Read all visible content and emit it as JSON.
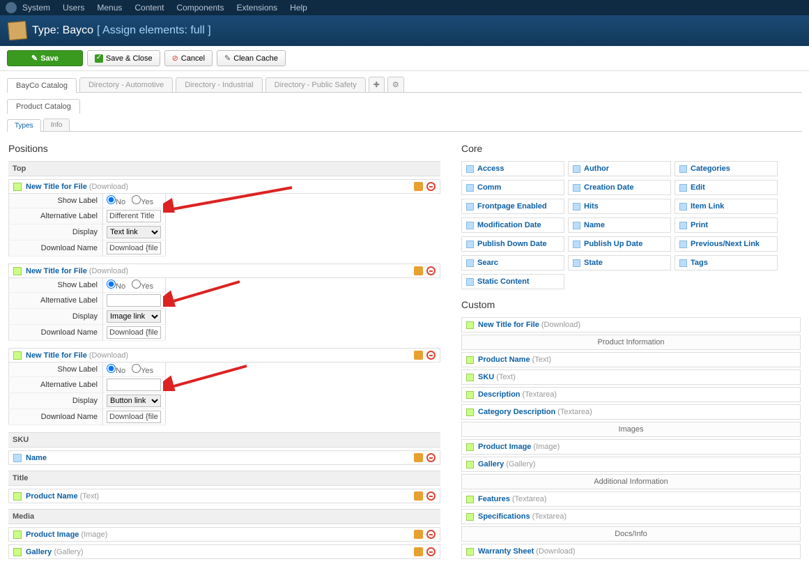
{
  "adminbar": [
    "System",
    "Users",
    "Menus",
    "Content",
    "Components",
    "Extensions",
    "Help"
  ],
  "header": {
    "title": "Type: Bayco",
    "sub": "[ Assign elements: full ]"
  },
  "toolbar": {
    "save": "Save",
    "saveclose": "Save & Close",
    "cancel": "Cancel",
    "clean": "Clean Cache"
  },
  "tabs1": [
    "BayCo Catalog",
    "Directory - Automotive",
    "Directory - Industrial",
    "Directory - Public Safety"
  ],
  "tabs2": [
    "Product Catalog"
  ],
  "subtabs": [
    "Types",
    "Info"
  ],
  "left_title": "Positions",
  "top": {
    "head": "Top",
    "items": [
      {
        "name": "New Title for File",
        "type": "(Download)",
        "show_label": "Show Label",
        "no": "No",
        "yes": "Yes",
        "alt": "Alternative Label",
        "alt_val": "Different Title",
        "disp": "Display",
        "disp_val": "Text link",
        "dn": "Download Name",
        "dn_val": "Download {filenan"
      },
      {
        "name": "New Title for File",
        "type": "(Download)",
        "show_label": "Show Label",
        "no": "No",
        "yes": "Yes",
        "alt": "Alternative Label",
        "alt_val": "",
        "disp": "Display",
        "disp_val": "Image link",
        "dn": "Download Name",
        "dn_val": "Download {filenan"
      },
      {
        "name": "New Title for File",
        "type": "(Download)",
        "show_label": "Show Label",
        "no": "No",
        "yes": "Yes",
        "alt": "Alternative Label",
        "alt_val": "",
        "disp": "Display",
        "disp_val": "Button link",
        "dn": "Download Name",
        "dn_val": "Download {filenan"
      }
    ]
  },
  "sku": {
    "head": "SKU",
    "item": "Name"
  },
  "title_sec": {
    "head": "Title",
    "item": "Product Name",
    "type": "(Text)"
  },
  "media": {
    "head": "Media",
    "items": [
      {
        "n": "Product Image",
        "t": "(Image)"
      },
      {
        "n": "Gallery",
        "t": "(Gallery)"
      }
    ]
  },
  "right": {
    "core_title": "Core",
    "core": [
      "Access",
      "Author",
      "Categories",
      "Comm",
      "Creation Date",
      "Edit",
      "Frontpage Enabled",
      "Hits",
      "Item Link",
      "Modification Date",
      "Name",
      "Print",
      "Publish Down Date",
      "Publish Up Date",
      "Previous/Next Link",
      "Searc",
      "State",
      "Tags",
      "Static Content"
    ],
    "custom_title": "Custom",
    "custom": {
      "first": {
        "n": "New Title for File",
        "t": "(Download)"
      },
      "groups": [
        {
          "head": "Product Information",
          "rows": [
            {
              "n": "Product Name",
              "t": "(Text)"
            },
            {
              "n": "SKU",
              "t": "(Text)"
            },
            {
              "n": "Description",
              "t": "(Textarea)"
            },
            {
              "n": "Category Description",
              "t": "(Textarea)"
            }
          ]
        },
        {
          "head": "Images",
          "rows": [
            {
              "n": "Product Image",
              "t": "(Image)"
            },
            {
              "n": "Gallery",
              "t": "(Gallery)"
            }
          ]
        },
        {
          "head": "Additional Information",
          "rows": [
            {
              "n": "Features",
              "t": "(Textarea)"
            },
            {
              "n": "Specifications",
              "t": "(Textarea)"
            }
          ]
        },
        {
          "head": "Docs/Info",
          "rows": [
            {
              "n": "Warranty Sheet",
              "t": "(Download)"
            }
          ]
        }
      ]
    }
  }
}
